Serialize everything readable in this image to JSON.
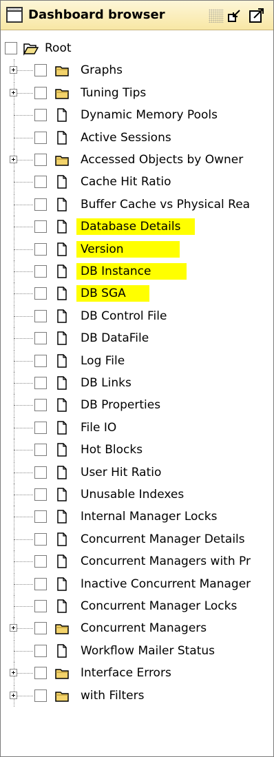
{
  "window": {
    "title": "Dashboard browser",
    "title_bar_color": "#f8e7a4",
    "highlight_color": "#ffff00"
  },
  "tree": {
    "root": {
      "label": "Root",
      "icon": "open-folder-icon"
    },
    "items": [
      {
        "label": "Graphs",
        "type": "folder",
        "expandable": true,
        "highlighted": false
      },
      {
        "label": "Tuning Tips",
        "type": "folder",
        "expandable": true,
        "highlighted": false
      },
      {
        "label": "Dynamic Memory Pools",
        "type": "document",
        "expandable": false,
        "highlighted": false
      },
      {
        "label": "Active Sessions",
        "type": "document",
        "expandable": false,
        "highlighted": false
      },
      {
        "label": "Accessed Objects by Owner",
        "type": "folder",
        "expandable": true,
        "highlighted": false
      },
      {
        "label": "Cache Hit Ratio",
        "type": "document",
        "expandable": false,
        "highlighted": false
      },
      {
        "label": "Buffer Cache vs Physical Rea",
        "type": "document",
        "expandable": false,
        "highlighted": false
      },
      {
        "label": "Database Details",
        "type": "document",
        "expandable": false,
        "highlighted": true
      },
      {
        "label": "Version",
        "type": "document",
        "expandable": false,
        "highlighted": true
      },
      {
        "label": "DB Instance",
        "type": "document",
        "expandable": false,
        "highlighted": true
      },
      {
        "label": "DB SGA",
        "type": "document",
        "expandable": false,
        "highlighted": true
      },
      {
        "label": "DB Control File",
        "type": "document",
        "expandable": false,
        "highlighted": false
      },
      {
        "label": "DB DataFile",
        "type": "document",
        "expandable": false,
        "highlighted": false
      },
      {
        "label": "Log File",
        "type": "document",
        "expandable": false,
        "highlighted": false
      },
      {
        "label": "DB Links",
        "type": "document",
        "expandable": false,
        "highlighted": false
      },
      {
        "label": "DB Properties",
        "type": "document",
        "expandable": false,
        "highlighted": false
      },
      {
        "label": "File IO",
        "type": "document",
        "expandable": false,
        "highlighted": false
      },
      {
        "label": "Hot Blocks",
        "type": "document",
        "expandable": false,
        "highlighted": false
      },
      {
        "label": "User Hit Ratio",
        "type": "document",
        "expandable": false,
        "highlighted": false
      },
      {
        "label": "Unusable Indexes",
        "type": "document",
        "expandable": false,
        "highlighted": false
      },
      {
        "label": "Internal Manager Locks",
        "type": "document",
        "expandable": false,
        "highlighted": false
      },
      {
        "label": "Concurrent Manager Details",
        "type": "document",
        "expandable": false,
        "highlighted": false
      },
      {
        "label": "Concurrent Managers with Pr",
        "type": "document",
        "expandable": false,
        "highlighted": false
      },
      {
        "label": "Inactive Concurrent Manager",
        "type": "document",
        "expandable": false,
        "highlighted": false
      },
      {
        "label": "Concurrent Manager Locks",
        "type": "document",
        "expandable": false,
        "highlighted": false
      },
      {
        "label": "Concurrent Managers",
        "type": "folder",
        "expandable": true,
        "highlighted": false
      },
      {
        "label": "Workflow Mailer Status",
        "type": "document",
        "expandable": false,
        "highlighted": false
      },
      {
        "label": "Interface Errors",
        "type": "folder",
        "expandable": true,
        "highlighted": false
      },
      {
        "label": "with Filters",
        "type": "folder",
        "expandable": true,
        "highlighted": false
      }
    ]
  }
}
